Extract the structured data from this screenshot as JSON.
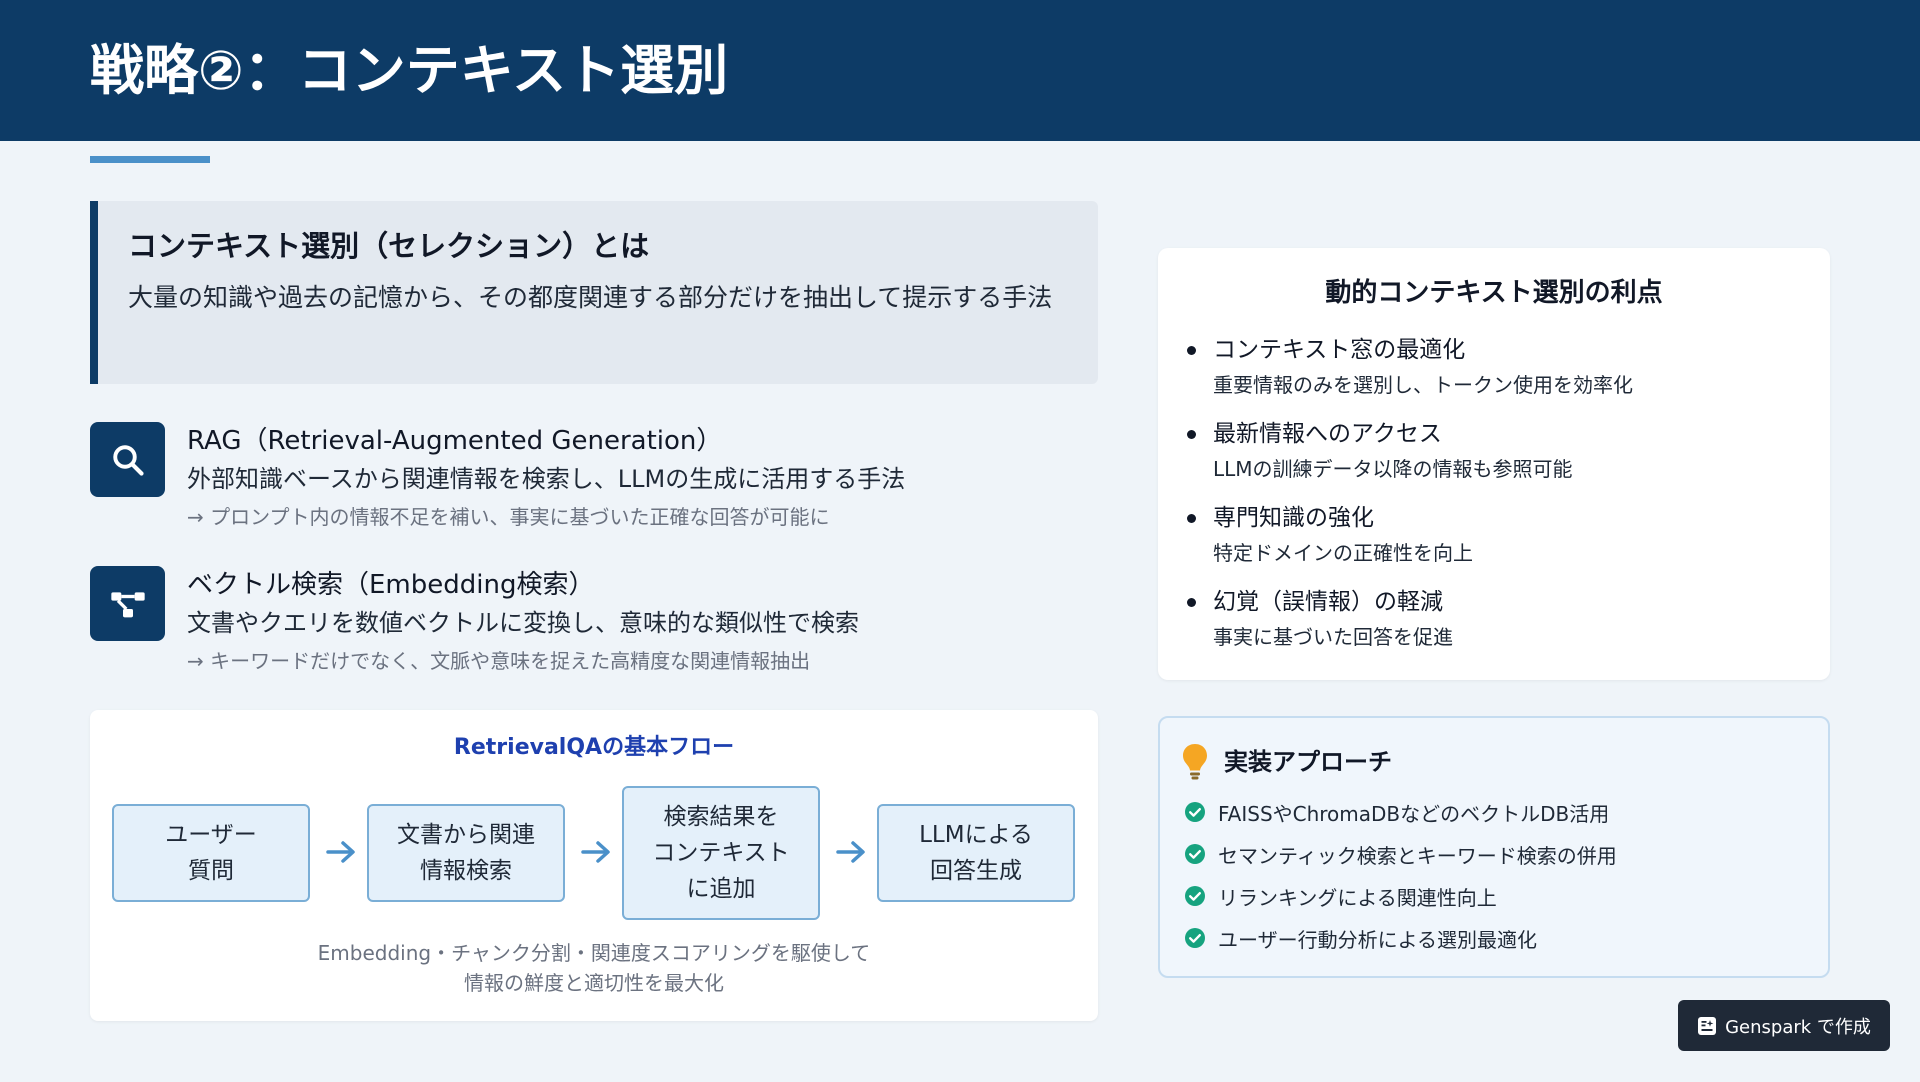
{
  "header": {
    "title": "戦略②：コンテキスト選別"
  },
  "definition": {
    "title": "コンテキスト選別（セレクション）とは",
    "text": "大量の知識や過去の記憶から、その都度関連する部分だけを抽出して提示する手法"
  },
  "features": [
    {
      "icon": "search-icon",
      "title": "RAG（Retrieval-Augmented Generation）",
      "desc": "外部知識ベースから関連情報を検索し、LLMの生成に活用する手法",
      "note": "→ プロンプト内の情報不足を補い、事実に基づいた正確な回答が可能に"
    },
    {
      "icon": "vector-network-icon",
      "title": "ベクトル検索（Embedding検索）",
      "desc": "文書やクエリを数値ベクトルに変換し、意味的な類似性で検索",
      "note": "→ キーワードだけでなく、文脈や意味を捉えた高精度な関連情報抽出"
    }
  ],
  "flow": {
    "title": "RetrievalQAの基本フロー",
    "steps": [
      "ユーザー\n質問",
      "文書から関連\n情報検索",
      "検索結果を\nコンテキスト\nに追加",
      "LLMによる\n回答生成"
    ],
    "caption": "Embedding・チャンク分割・関連度スコアリングを駆使して\n情報の鮮度と適切性を最大化"
  },
  "benefits": {
    "title": "動的コンテキスト選別の利点",
    "items": [
      {
        "head": "コンテキスト窓の最適化",
        "sub": "重要情報のみを選別し、トークン使用を効率化"
      },
      {
        "head": "最新情報へのアクセス",
        "sub": "LLMの訓練データ以降の情報も参照可能"
      },
      {
        "head": "専門知識の強化",
        "sub": "特定ドメインの正確性を向上"
      },
      {
        "head": "幻覚（誤情報）の軽減",
        "sub": "事実に基づいた回答を促進"
      }
    ]
  },
  "implementation": {
    "title": "実装アプローチ",
    "items": [
      "FAISSやChromaDBなどのベクトルDB活用",
      "セマンティック検索とキーワード検索の併用",
      "リランキングによる関連性向上",
      "ユーザー行動分析による選別最適化"
    ]
  },
  "badge": {
    "label": "Genspark で作成"
  },
  "colors": {
    "navy": "#0d3b66",
    "accent": "#4a90c9",
    "check": "#16a37f",
    "bulb": "#f5a623"
  }
}
